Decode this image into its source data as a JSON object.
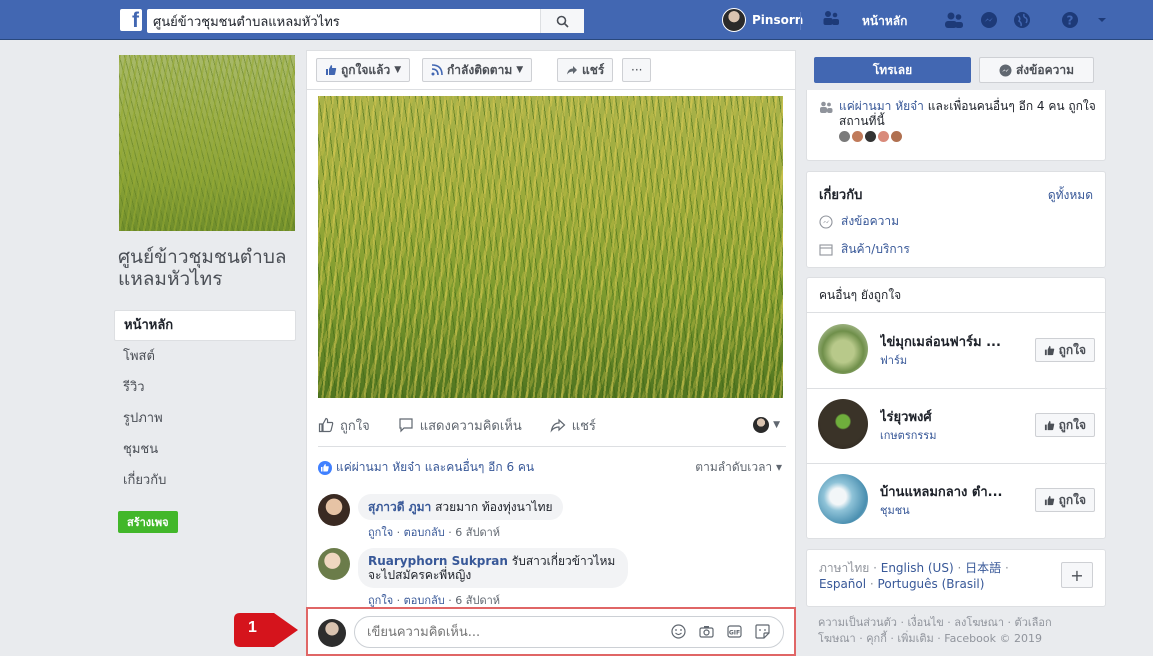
{
  "topbar": {
    "logo": "f",
    "search_value": "ศูนย์ข้าวชุมชนตำบลแหลมหัวไทร",
    "user_name": "Pinsorn",
    "home_label": "หน้าหลัก",
    "brand_color": "#4267b2"
  },
  "left": {
    "page_name": "ศูนย์ข้าวชุมชนตำบลแหลมหัวไทร",
    "nav": [
      "หน้าหลัก",
      "โพสต์",
      "รีวิว",
      "รูปภาพ",
      "ชุมชน",
      "เกี่ยวกับ"
    ],
    "create_page": "สร้างเพจ"
  },
  "actions": {
    "liked": "ถูกใจแล้ว",
    "following": "กำลังติดตาม",
    "share": "แชร์",
    "more": "···"
  },
  "post": {
    "like": "ถูกใจ",
    "comment": "แสดงความคิดเห็น",
    "share": "แชร์",
    "likes_summary": "แค่ผ่านมา หัยจ๋า และคนอื่นๆ อีก 6 คน",
    "sort": "ตามลำดับเวลา ▾",
    "comments": [
      {
        "author": "สุภาวดี ภูมา",
        "text": "สวยมาก ท้องทุ่งนาไทย",
        "like": "ถูกใจ",
        "reply": "ตอบกลับ",
        "time": "6 สัปดาห์"
      },
      {
        "author": "Ruaryphorn Sukpran",
        "text": "รับสาวเกี่ยวข้าวไหม จะไปสมัครคะพี่หญิง",
        "like": "ถูกใจ",
        "reply": "ตอบกลับ",
        "time": "6 สัปดาห์"
      }
    ],
    "composer_placeholder": "เขียนความคิดเห็น...",
    "callout_number": "1"
  },
  "right": {
    "call_button": "โทรเลย",
    "message_button": "ส่งข้อความ",
    "friends_name": "แค่ผ่านมา หัยจ๋า",
    "friends_rest": "และเพื่อนคนอื่นๆ อีก 4 คน ถูกใจสถานที่นี้",
    "about_title": "เกี่ยวกับ",
    "see_all": "ดูทั้งหมด",
    "about_items": [
      "ส่งข้อความ",
      "สินค้า/บริการ"
    ],
    "others_like_title": "คนอื่นๆ ยังถูกใจ",
    "suggestions": [
      {
        "name": "ไข่มุกเมล่อนฟาร์ม ...",
        "category": "ฟาร์ม",
        "like": "ถูกใจ"
      },
      {
        "name": "ไร่ยุวพงศ์",
        "category": "เกษตรกรรม",
        "like": "ถูกใจ"
      },
      {
        "name": "บ้านแหลมกลาง ตำ...",
        "category": "ชุมชน",
        "like": "ถูกใจ"
      }
    ],
    "lang_current": "ภาษาไทย",
    "lang_options": [
      "English (US)",
      "日本語",
      "Español",
      "Português (Brasil)"
    ],
    "footer": "ความเป็นส่วนตัว · เงื่อนไข · ลงโฆษณา · ตัวเลือกโฆษณา · คุกกี้ · เพิ่มเติม · Facebook © 2019"
  }
}
